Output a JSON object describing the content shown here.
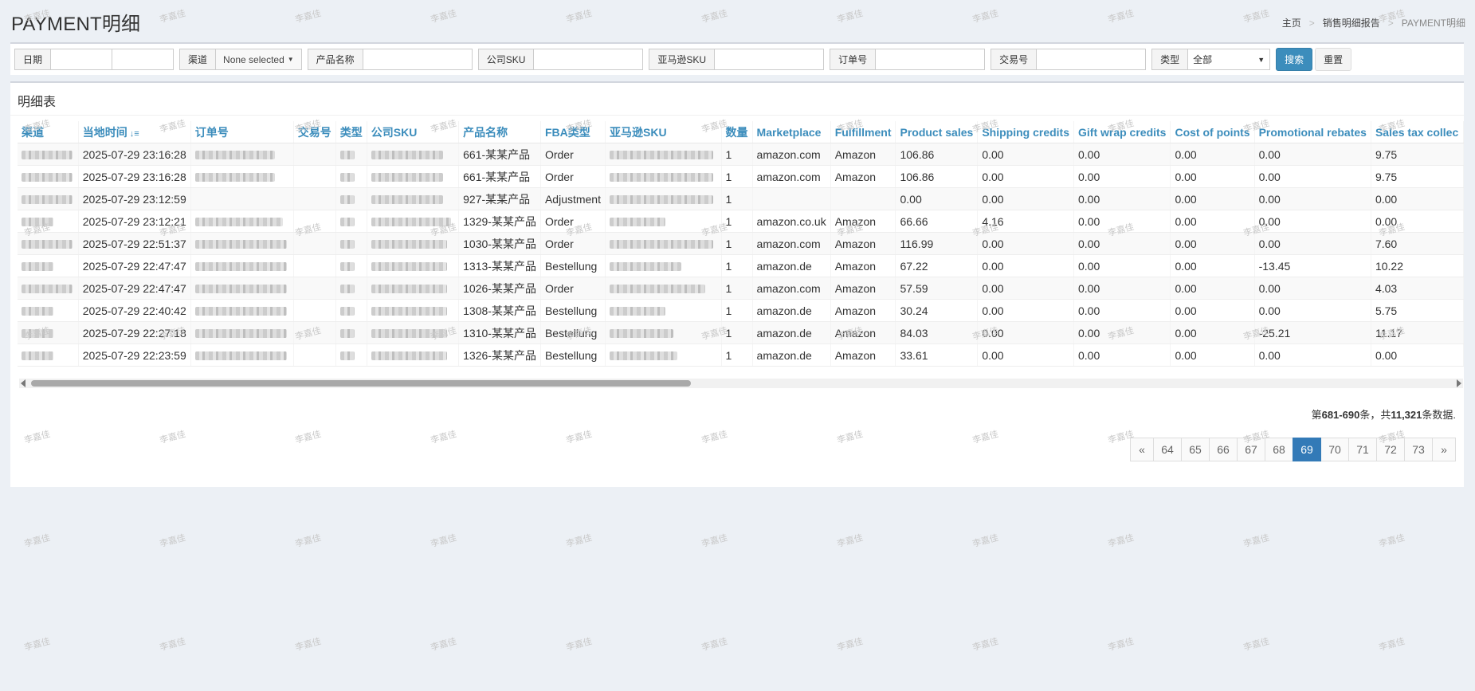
{
  "header": {
    "title": "PAYMENT明细"
  },
  "breadcrumb": {
    "home": "主页",
    "parent": "销售明细报告",
    "current": "PAYMENT明细"
  },
  "filters": {
    "date_label": "日期",
    "channel_label": "渠道",
    "channel_value": "None selected",
    "product_name_label": "产品名称",
    "company_sku_label": "公司SKU",
    "amazon_sku_label": "亚马逊SKU",
    "order_no_label": "订单号",
    "transaction_no_label": "交易号",
    "type_label": "类型",
    "type_value": "全部",
    "search_button": "搜索",
    "reset_button": "重置"
  },
  "table": {
    "title": "明细表",
    "columns": [
      "渠道",
      "当地时间",
      "订单号",
      "交易号",
      "类型",
      "公司SKU",
      "产品名称",
      "FBA类型",
      "亚马逊SKU",
      "数量",
      "Marketplace",
      "Fulfillment",
      "Product sales",
      "Shipping credits",
      "Gift wrap credits",
      "Cost of points",
      "Promotional rebates",
      "Sales tax collec"
    ],
    "rows": [
      {
        "time": "2025-07-29 23:16:28",
        "product": "661-某某产品",
        "fba_type": "Order",
        "qty": "1",
        "marketplace": "amazon.com",
        "fulfillment": "Amazon",
        "product_sales": "106.86",
        "shipping_credits": "0.00",
        "gift_wrap": "0.00",
        "cost_points": "0.00",
        "promo": "0.00",
        "sales_tax": "9.75"
      },
      {
        "time": "2025-07-29 23:16:28",
        "product": "661-某某产品",
        "fba_type": "Order",
        "qty": "1",
        "marketplace": "amazon.com",
        "fulfillment": "Amazon",
        "product_sales": "106.86",
        "shipping_credits": "0.00",
        "gift_wrap": "0.00",
        "cost_points": "0.00",
        "promo": "0.00",
        "sales_tax": "9.75"
      },
      {
        "time": "2025-07-29 23:12:59",
        "product": "927-某某产品",
        "fba_type": "Adjustment",
        "qty": "1",
        "marketplace": "",
        "fulfillment": "",
        "product_sales": "0.00",
        "shipping_credits": "0.00",
        "gift_wrap": "0.00",
        "cost_points": "0.00",
        "promo": "0.00",
        "sales_tax": "0.00"
      },
      {
        "time": "2025-07-29 23:12:21",
        "product": "1329-某某产品",
        "fba_type": "Order",
        "qty": "1",
        "marketplace": "amazon.co.uk",
        "fulfillment": "Amazon",
        "product_sales": "66.66",
        "shipping_credits": "4.16",
        "gift_wrap": "0.00",
        "cost_points": "0.00",
        "promo": "0.00",
        "sales_tax": "0.00"
      },
      {
        "time": "2025-07-29 22:51:37",
        "product": "1030-某某产品",
        "fba_type": "Order",
        "qty": "1",
        "marketplace": "amazon.com",
        "fulfillment": "Amazon",
        "product_sales": "116.99",
        "shipping_credits": "0.00",
        "gift_wrap": "0.00",
        "cost_points": "0.00",
        "promo": "0.00",
        "sales_tax": "7.60"
      },
      {
        "time": "2025-07-29 22:47:47",
        "product": "1313-某某产品",
        "fba_type": "Bestellung",
        "qty": "1",
        "marketplace": "amazon.de",
        "fulfillment": "Amazon",
        "product_sales": "67.22",
        "shipping_credits": "0.00",
        "gift_wrap": "0.00",
        "cost_points": "0.00",
        "promo": "-13.45",
        "sales_tax": "10.22"
      },
      {
        "time": "2025-07-29 22:47:47",
        "product": "1026-某某产品",
        "fba_type": "Order",
        "qty": "1",
        "marketplace": "amazon.com",
        "fulfillment": "Amazon",
        "product_sales": "57.59",
        "shipping_credits": "0.00",
        "gift_wrap": "0.00",
        "cost_points": "0.00",
        "promo": "0.00",
        "sales_tax": "4.03"
      },
      {
        "time": "2025-07-29 22:40:42",
        "product": "1308-某某产品",
        "fba_type": "Bestellung",
        "qty": "1",
        "marketplace": "amazon.de",
        "fulfillment": "Amazon",
        "product_sales": "30.24",
        "shipping_credits": "0.00",
        "gift_wrap": "0.00",
        "cost_points": "0.00",
        "promo": "0.00",
        "sales_tax": "5.75"
      },
      {
        "time": "2025-07-29 22:27:18",
        "product": "1310-某某产品",
        "fba_type": "Bestellung",
        "qty": "1",
        "marketplace": "amazon.de",
        "fulfillment": "Amazon",
        "product_sales": "84.03",
        "shipping_credits": "0.00",
        "gift_wrap": "0.00",
        "cost_points": "0.00",
        "promo": "-25.21",
        "sales_tax": "11.17"
      },
      {
        "time": "2025-07-29 22:23:59",
        "product": "1326-某某产品",
        "fba_type": "Bestellung",
        "qty": "1",
        "marketplace": "amazon.de",
        "fulfillment": "Amazon",
        "product_sales": "33.61",
        "shipping_credits": "0.00",
        "gift_wrap": "0.00",
        "cost_points": "0.00",
        "promo": "0.00",
        "sales_tax": "0.00"
      }
    ]
  },
  "summary": {
    "prefix": "第",
    "range": "681-690",
    "mid": "条，共",
    "total": "11,321",
    "suffix": "条数据."
  },
  "pagination": {
    "prev": "«",
    "pages": [
      "64",
      "65",
      "66",
      "67",
      "68",
      "69",
      "70",
      "71",
      "72",
      "73"
    ],
    "active": "69",
    "next": "»"
  },
  "watermark_text": "李嘉佳",
  "colors": {
    "accent": "#3c8dbc",
    "page_bg": "#ecf0f5",
    "active_page": "#337ab7"
  },
  "icons": {
    "sort": "sort-desc-icon"
  }
}
